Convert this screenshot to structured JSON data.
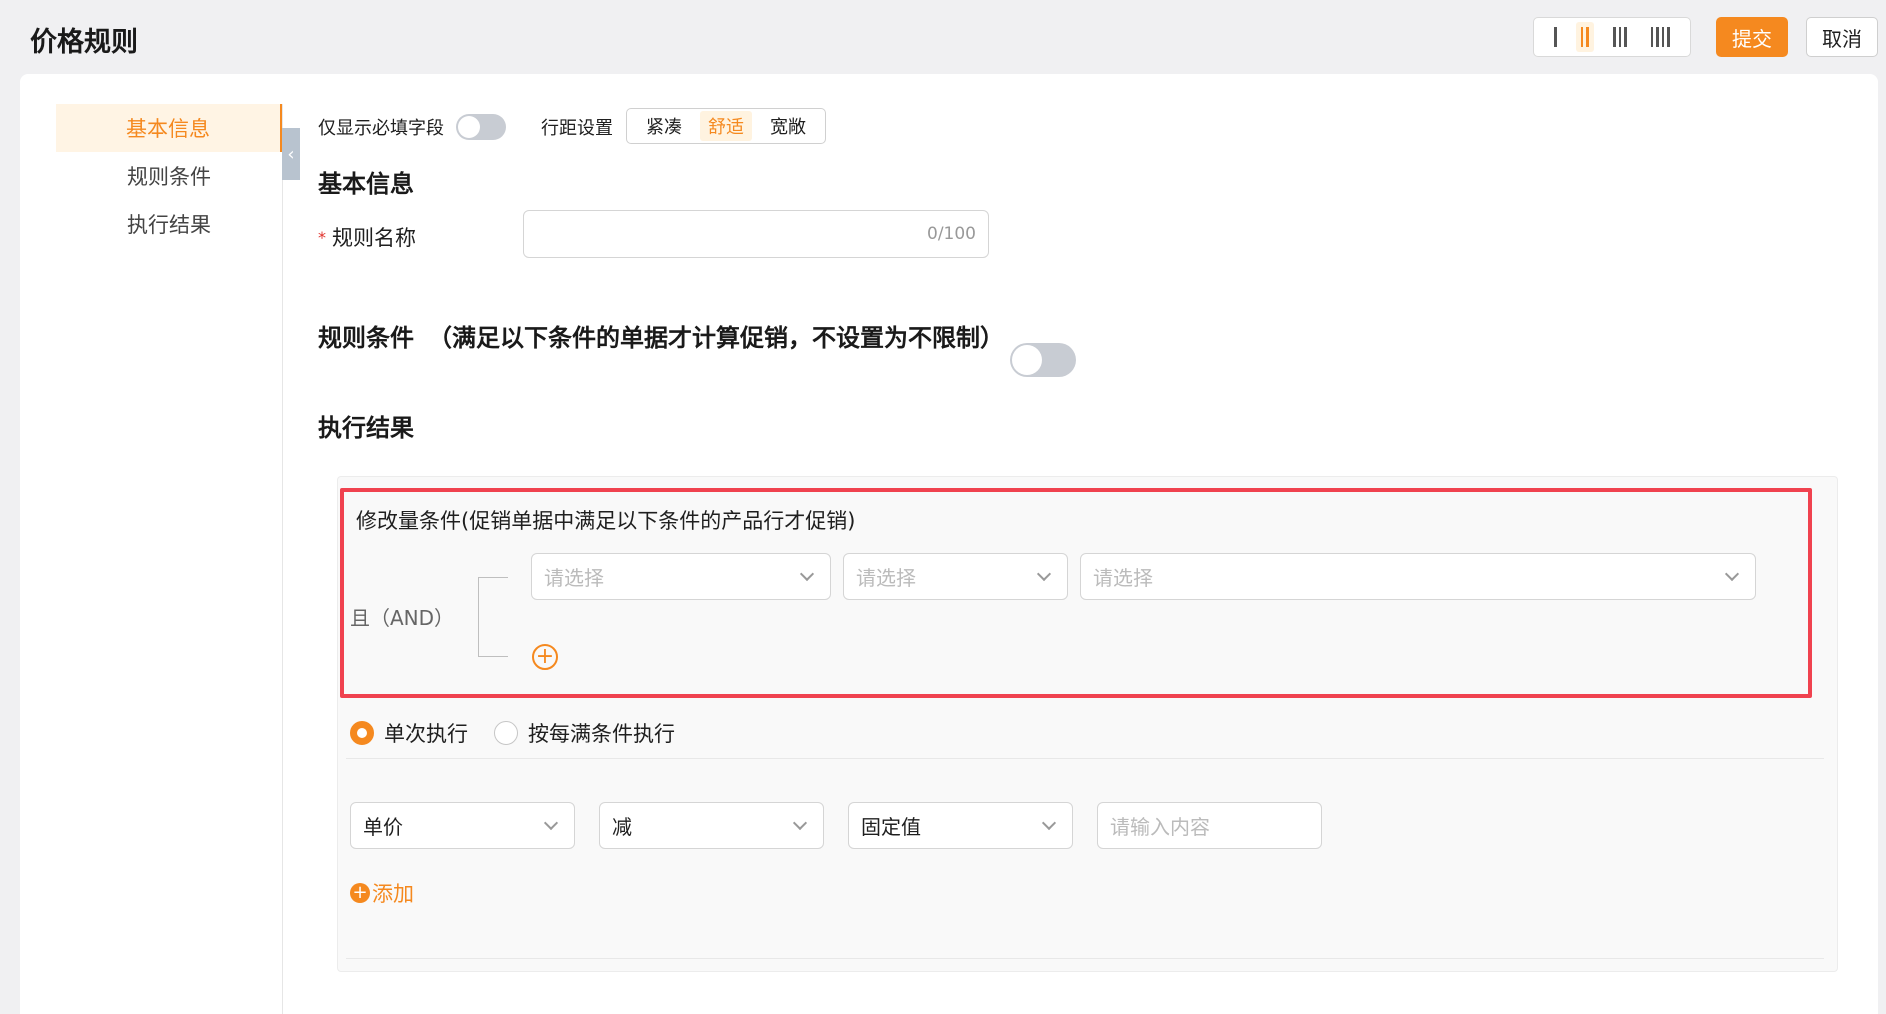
{
  "header": {
    "title": "价格规则",
    "column_options": [
      "1",
      "2",
      "3",
      "4"
    ],
    "active_column": 2,
    "submit_label": "提交",
    "cancel_label": "取消"
  },
  "nav": {
    "items": [
      {
        "label": "基本信息",
        "active": true
      },
      {
        "label": "规则条件",
        "active": false
      },
      {
        "label": "执行结果",
        "active": false
      }
    ]
  },
  "toolbar": {
    "required_only_label": "仅显示必填字段",
    "required_only_on": false,
    "line_spacing_label": "行距设置",
    "spacing_options": [
      "紧凑",
      "舒适",
      "宽敞"
    ],
    "spacing_selected": "舒适"
  },
  "basic": {
    "title": "基本信息",
    "rule_name_label": "规则名称",
    "rule_name_value": "",
    "rule_name_counter": "0/100"
  },
  "conditions": {
    "title": "规则条件",
    "hint": "（满足以下条件的单据才计算促销，不设置为不限制）",
    "enabled": false
  },
  "result": {
    "title": "执行结果",
    "qty_condition_title": "修改量条件(促销单据中满足以下条件的产品行才促销)",
    "logic_label": "且（AND）",
    "selects": [
      "请选择",
      "请选择",
      "请选择"
    ],
    "exec_modes": [
      {
        "label": "单次执行",
        "checked": true
      },
      {
        "label": "按每满条件执行",
        "checked": false
      }
    ],
    "action": {
      "field": "单价",
      "operator": "减",
      "value_type": "固定值",
      "value_placeholder": "请输入内容"
    },
    "add_label": "添加"
  },
  "colors": {
    "accent": "#f5891f",
    "highlight": "#f0424f"
  }
}
